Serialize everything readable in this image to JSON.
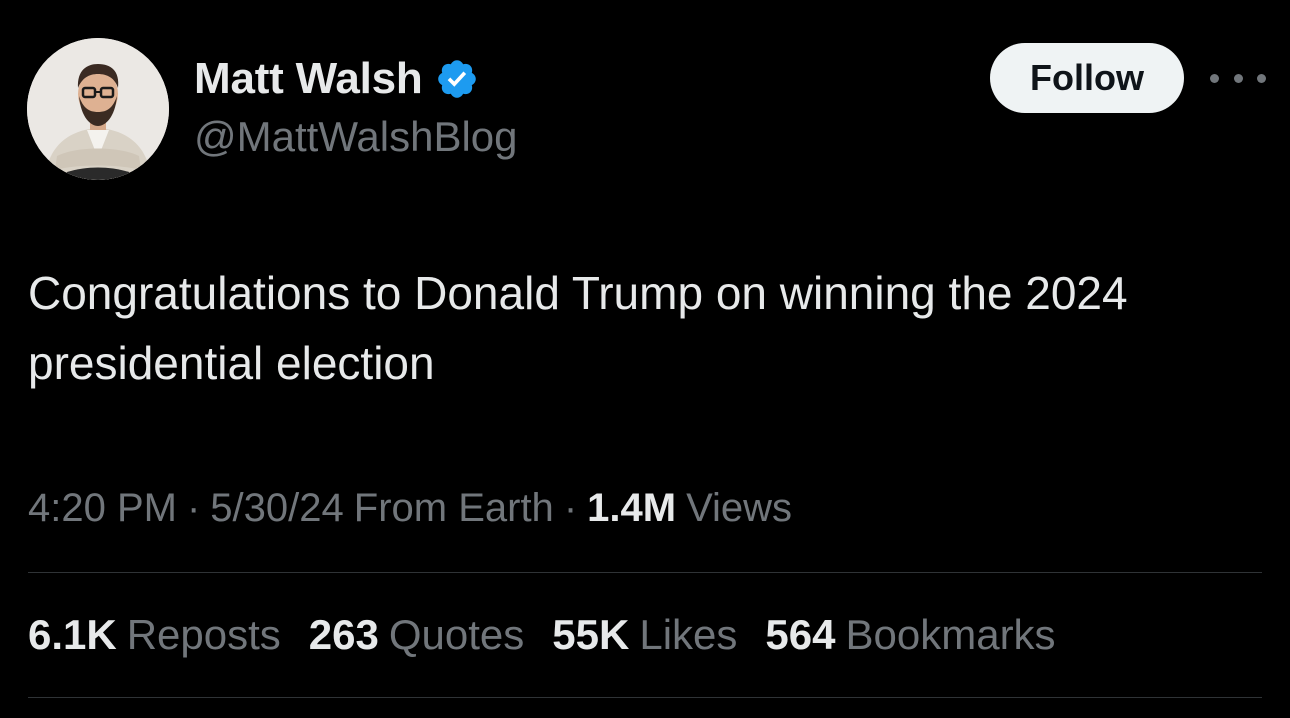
{
  "author": {
    "display_name": "Matt Walsh",
    "handle": "@MattWalshBlog",
    "verified": true,
    "verified_color": "#1d9bf0"
  },
  "actions": {
    "follow_label": "Follow",
    "more_icon": "more-horizontal-icon"
  },
  "tweet": {
    "text": "Congratulations to Donald Trump on winning the 2024 presidential election"
  },
  "meta": {
    "time": "4:20 PM",
    "date": "5/30/24",
    "source": "From Earth",
    "separator": "·",
    "views_count": "1.4M",
    "views_label": "Views"
  },
  "stats": [
    {
      "count": "6.1K",
      "label": "Reposts"
    },
    {
      "count": "263",
      "label": "Quotes"
    },
    {
      "count": "55K",
      "label": "Likes"
    },
    {
      "count": "564",
      "label": "Bookmarks"
    }
  ],
  "colors": {
    "background": "#000000",
    "primary_text": "#e7e9ea",
    "secondary_text": "#71767b",
    "divider": "#2f3336",
    "follow_bg": "#eff3f4"
  }
}
